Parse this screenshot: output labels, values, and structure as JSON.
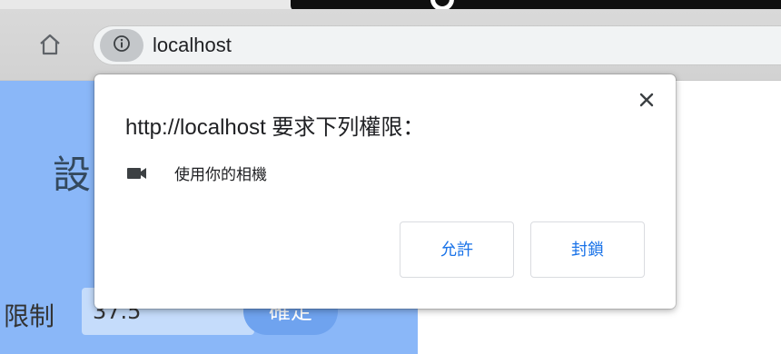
{
  "browser": {
    "url": "localhost",
    "home_icon": "home-icon",
    "site_info_icon": "info-icon"
  },
  "page": {
    "heading_fragment": "設",
    "limit_label": "限制",
    "limit_value": "37.5",
    "confirm_label": "確定",
    "panel_color": "#8ab7f8"
  },
  "permission_dialog": {
    "title": "http://localhost 要求下列權限：",
    "permission_icon": "camera-icon",
    "permission_text": "使用你的相機",
    "allow_label": "允許",
    "block_label": "封鎖",
    "close_icon": "close-icon",
    "button_text_color": "#1a73e8"
  }
}
